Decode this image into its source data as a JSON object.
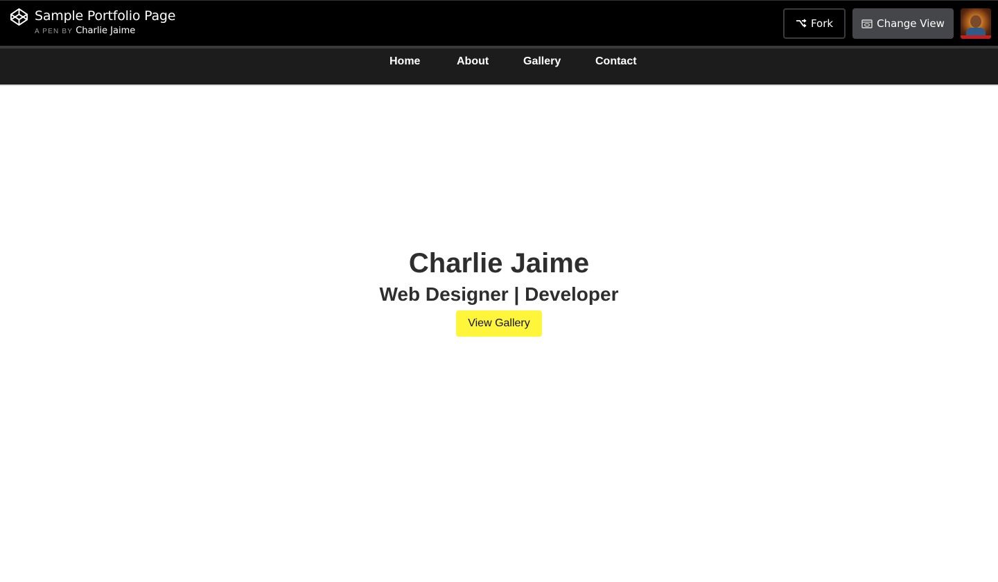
{
  "codepen": {
    "title": "Sample Portfolio Page",
    "byline_prefix": "A PEN BY",
    "author": "Charlie Jaime",
    "fork_label": "Fork",
    "change_view_label": "Change View",
    "icons": {
      "logo": "codepen-logo-icon",
      "fork": "fork-icon",
      "change_view": "change-view-icon"
    }
  },
  "nav": {
    "items": [
      {
        "label": "Home"
      },
      {
        "label": "About"
      },
      {
        "label": "Gallery"
      },
      {
        "label": "Contact"
      }
    ]
  },
  "hero": {
    "name": "Charlie Jaime",
    "subtitle": "Web Designer | Developer",
    "button_label": "View Gallery"
  },
  "colors": {
    "topbar": "#000000",
    "nav_bg": "#1c1c1c",
    "button_yellow": "#fff53b",
    "text_dark": "#2e2e2e"
  }
}
